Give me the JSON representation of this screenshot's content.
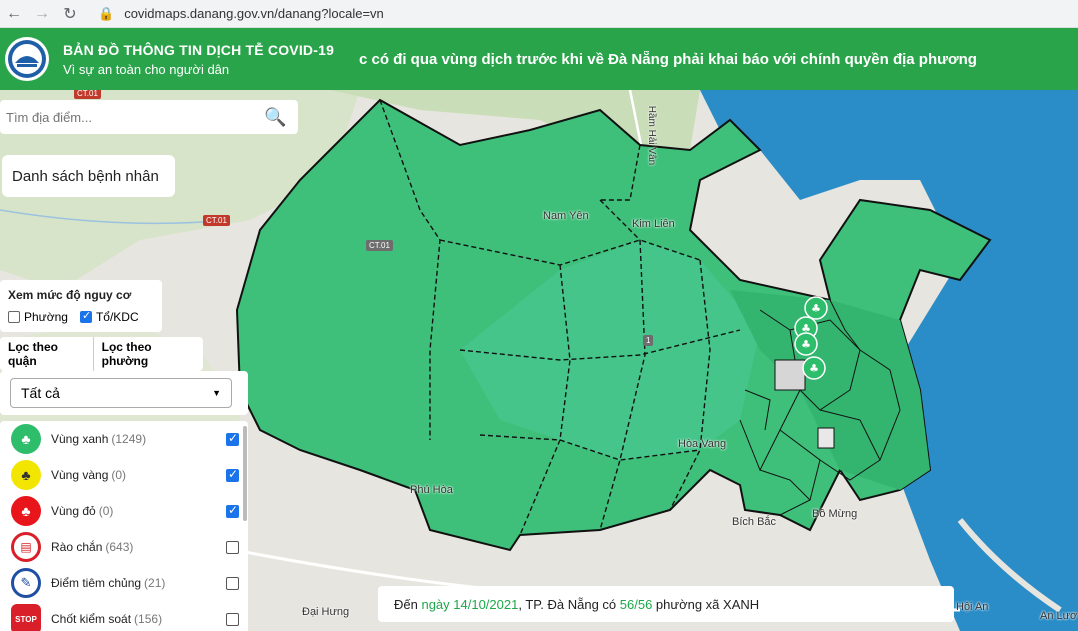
{
  "browser": {
    "url": "covidmaps.danang.gov.vn/danang?locale=vn"
  },
  "header": {
    "title": "BẢN ĐỒ THÔNG TIN DỊCH TỄ COVID-19",
    "subtitle": "Vì sự an toàn cho người dân",
    "marquee": "c có đi qua vùng dịch trước khi về Đà Nẵng phải khai báo với chính quyền địa phương"
  },
  "search": {
    "placeholder": "Tìm địa điểm..."
  },
  "patients_button": "Danh sách bệnh nhân",
  "risk": {
    "heading": "Xem mức độ nguy cơ",
    "options": [
      {
        "label": "Phường",
        "checked": false
      },
      {
        "label": "Tổ/KDC",
        "checked": true
      }
    ]
  },
  "filter_tabs": [
    "Lọc theo quận",
    "Lọc theo phường"
  ],
  "district_select": "Tất cả",
  "legend": [
    {
      "label": "Vùng xanh",
      "count": "(1249)",
      "color": "#2ebd6b",
      "icon": "tree-icon",
      "checked": true
    },
    {
      "label": "Vùng vàng",
      "count": "(0)",
      "color": "#f2e600",
      "icon": "tree-icon",
      "checked": true
    },
    {
      "label": "Vùng đỏ",
      "count": "(0)",
      "color": "#e8161a",
      "icon": "tree-icon",
      "checked": true
    },
    {
      "label": "Rào chắn",
      "count": "(643)",
      "color": "#d9202a",
      "icon": "barrier-icon",
      "checked": false
    },
    {
      "label": "Điểm tiêm chủng",
      "count": "(21)",
      "color": "#1f4fa3",
      "icon": "syringe-icon",
      "checked": false
    },
    {
      "label": "Chốt kiểm soát",
      "count": "(156)",
      "color": "#d9202a",
      "icon": "stop-icon",
      "checked": false
    }
  ],
  "status": {
    "prefix": "Đến ",
    "date": "ngày 14/10/2021",
    "middle": ", TP. Đà Nẵng có ",
    "ratio": "56/56",
    "suffix": " phường xã XANH"
  },
  "map_labels": {
    "nam_yen": "Nam Yên",
    "kim_lien": "Kim Liên",
    "hoa_vang": "Hòa Vang",
    "phu_hoa": "Phú Hòa",
    "bich_bac": "Bích Bắc",
    "bo_mung": "Bồ Mừng",
    "dai_hung": "Đại Hưng",
    "hoi_an": "Hội An",
    "an_luong": "An Lươ",
    "hai_van": "Hầm Hải Vân",
    "ct01_a": "CT.01",
    "ct01_b": "CT.01",
    "ct01_c": "CT.01",
    "route1": "1"
  }
}
